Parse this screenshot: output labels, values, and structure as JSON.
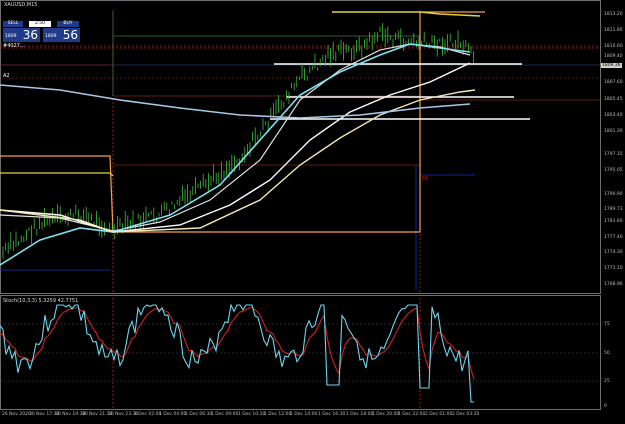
{
  "window": {
    "title": "XAUUSD,M15"
  },
  "top_info": "XAUUSD,M15  1810.05  1811.10  1809.88  1809.36",
  "trade_panel": {
    "sell_label": "SELL",
    "buy_label": "BUY",
    "lot_value": "2.50",
    "sell_price_small": "1809",
    "sell_price_big": "36",
    "buy_price_small": "1809",
    "buy_price_big": "56"
  },
  "side_labels": {
    "left_tag1": "#4027...",
    "left_tag2": "A2"
  },
  "price_axis": [
    "1813.20",
    "1811.80",
    "1810.60",
    "1809.40",
    "1807.60",
    "1805.45",
    "1803.40",
    "1801.30",
    "1797.15",
    "1795.05",
    "1790.90",
    "1789.73",
    "1783.60",
    "1777.40",
    "1774.30",
    "1771.10",
    "1768.96"
  ],
  "current_price_tag": "1809.36",
  "marker_label": "61",
  "stoch": {
    "label": "Stoch(10,3,3) 5.3259 42.7751",
    "levels": [
      "75",
      "50",
      "25",
      "0"
    ]
  },
  "time_axis": [
    "26 Nov 2020",
    "30 Nov 17:30",
    "30 Nov 19:30",
    "30 Nov 21:30",
    "30 Nov 23:30",
    "1 Dec 02:00",
    "1 Dec 04:00",
    "1 Dec 06:30",
    "1 Dec 09:00",
    "1 Dec 10:30",
    "1 Dec 12:00",
    "1 Dec 14:00",
    "1 Dec 16:30",
    "1 Dec 18:00",
    "1 Dec 20:00",
    "1 Dec 22:00",
    "2 Dec 01:00",
    "2 Dec 03:30"
  ],
  "colors": {
    "background": "#000000",
    "candle": "#3fbf3f",
    "ma_fast": "#e0e0e0",
    "ma_cyan": "#7ee0ef",
    "ma_white": "#ffffff",
    "ma_beige": "#f5e6b0",
    "stoch_main": "#6fd6ee",
    "stoch_signal": "#d02020",
    "orange_line": "#f5a050",
    "yellow_line": "#e6d23c",
    "red_level": "#b02020"
  }
}
